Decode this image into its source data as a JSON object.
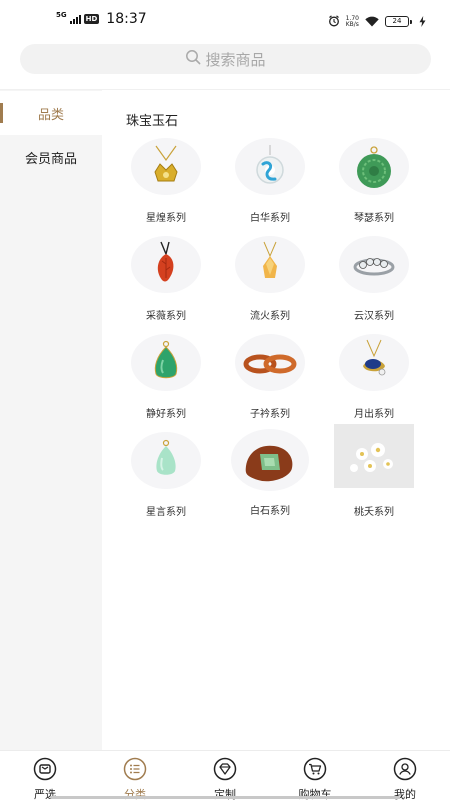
{
  "status_bar": {
    "network": "5G",
    "hd": "HD",
    "time": "18:37",
    "speed_value": "1.70",
    "speed_unit": "KB/s",
    "battery": "24"
  },
  "search": {
    "placeholder": "搜索商品"
  },
  "sidebar": {
    "items": [
      {
        "label": "品类",
        "active": true
      },
      {
        "label": "会员商品",
        "active": false
      }
    ]
  },
  "section": {
    "title": "珠宝玉石"
  },
  "products": [
    {
      "label": "星煌系列",
      "icon": "gold-crown-pendant"
    },
    {
      "label": "白华系列",
      "icon": "jade-ring-pendant"
    },
    {
      "label": "琴瑟系列",
      "icon": "green-carved-jade-pendant"
    },
    {
      "label": "采薇系列",
      "icon": "red-leaf-pendant"
    },
    {
      "label": "流火系列",
      "icon": "citrine-pendant"
    },
    {
      "label": "云汉系列",
      "icon": "silver-gem-ring"
    },
    {
      "label": "静好系列",
      "icon": "green-teardrop-pendant"
    },
    {
      "label": "子衿系列",
      "icon": "red-agate-bangles"
    },
    {
      "label": "月出系列",
      "icon": "sapphire-pendant"
    },
    {
      "label": "星言系列",
      "icon": "mint-jade-pendant"
    },
    {
      "label": "白石系列",
      "icon": "green-inlay-stone"
    },
    {
      "label": "桃夭系列",
      "icon": "white-flowers-photo"
    }
  ],
  "bottom_nav": [
    {
      "label": "严选",
      "icon": "mailbox-icon",
      "active": false
    },
    {
      "label": "分类",
      "icon": "list-icon",
      "active": true
    },
    {
      "label": "定制",
      "icon": "diamond-icon",
      "active": false
    },
    {
      "label": "购物车",
      "icon": "cart-icon",
      "active": false
    },
    {
      "label": "我的",
      "icon": "user-icon",
      "active": false
    }
  ],
  "colors": {
    "accent": "#a07c4f",
    "sidebar_bg": "#f5f5f5",
    "search_bg": "#f2f2f2"
  }
}
